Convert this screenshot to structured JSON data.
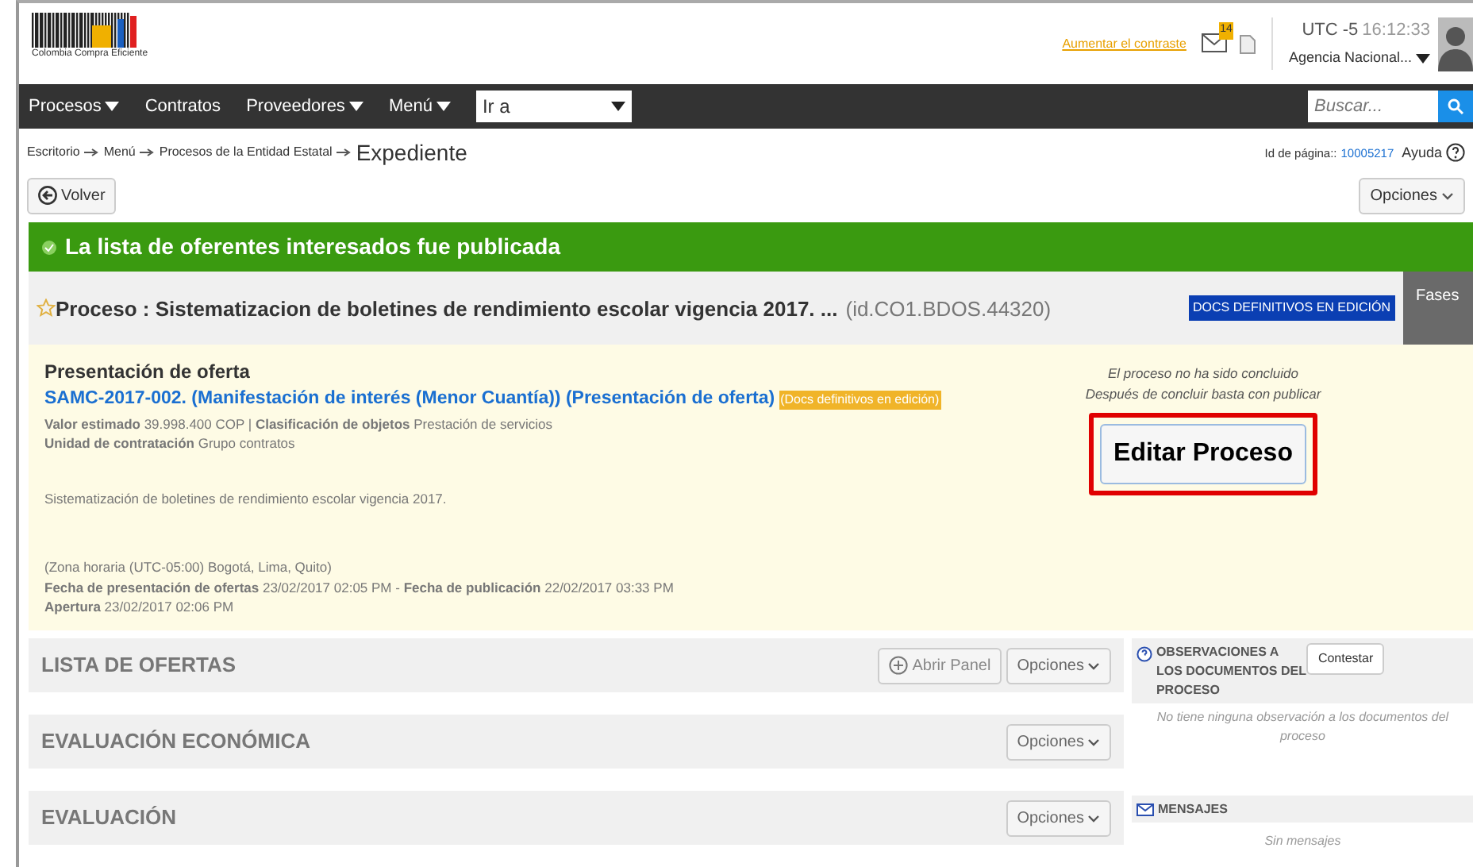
{
  "header": {
    "logo_text": "Colombia Compra Eficiente",
    "contrast_link": "Aumentar el contraste",
    "notification_count": "14",
    "clock_zone": "UTC -5",
    "clock_time": "16:12:33",
    "agency": "Agencia Nacional..."
  },
  "nav": {
    "items": [
      {
        "label": "Procesos",
        "dropdown": true
      },
      {
        "label": "Contratos",
        "dropdown": false
      },
      {
        "label": "Proveedores",
        "dropdown": true
      },
      {
        "label": "Menú",
        "dropdown": true
      }
    ],
    "goto": "Ir a",
    "search_placeholder": "Buscar..."
  },
  "breadcrumb": {
    "items": [
      {
        "label": "Escritorio",
        "current": false
      },
      {
        "label": "Menú",
        "current": false
      },
      {
        "label": "Procesos de la Entidad Estatal",
        "current": false
      },
      {
        "label": "Expediente",
        "current": true
      }
    ],
    "page_id_label": "Id de página::",
    "page_id": "10005217",
    "help": "Ayuda"
  },
  "toolbar": {
    "back": "Volver",
    "options": "Opciones"
  },
  "banner": "La lista de oferentes interesados fue publicada",
  "process": {
    "title": "Proceso : Sistematizacion de boletines de rendimiento escolar vigencia 2017. ...",
    "id": "(id.CO1.BDOS.44320)",
    "status": "DOCS DEFINITIVOS EN EDICIÓN",
    "phases": "Fases"
  },
  "detail": {
    "phase": "Presentación de oferta",
    "reference": "SAMC-2017-002. (Manifestación de interés (Menor Cuantía)) (Presentación de oferta)",
    "tag": "(Docs definitivos en edición)",
    "facts": [
      "**Valor estimado** 39.998.400 COP | **Clasificación de objetos**  Prestación de servicios",
      "**Unidad de contratación** Grupo contratos"
    ],
    "description": "Sistematización de boletines de rendimiento escolar vigencia 2017.",
    "timezone": "(Zona horaria (UTC-05:00) Bogotá, Lima, Quito)",
    "dates": [
      "**Fecha de presentación de ofertas** 23/02/2017 02:05 PM - **Fecha de publicación** 22/02/2017 03:33 PM",
      "**Apertura** 23/02/2017 02:06 PM"
    ],
    "notes": [
      "El proceso no ha sido concluido",
      "Después de concluir basta con publicar"
    ],
    "edit_button": "Editar Proceso"
  },
  "sections": [
    {
      "title": "LISTA DE OFERTAS",
      "open_panel": "Abrir Panel",
      "options": "Opciones"
    },
    {
      "title": "EVALUACIÓN ECONÓMICA",
      "options": "Opciones"
    },
    {
      "title": "EVALUACIÓN",
      "options": "Opciones"
    }
  ],
  "side": {
    "observations_title": "OBSERVACIONES A LOS DOCUMENTOS DEL PROCESO",
    "reply": "Contestar",
    "observations_empty": "No tiene ninguna observación a los documentos del proceso",
    "messages_title": "MENSAJES",
    "messages_empty": "Sin mensajes"
  }
}
